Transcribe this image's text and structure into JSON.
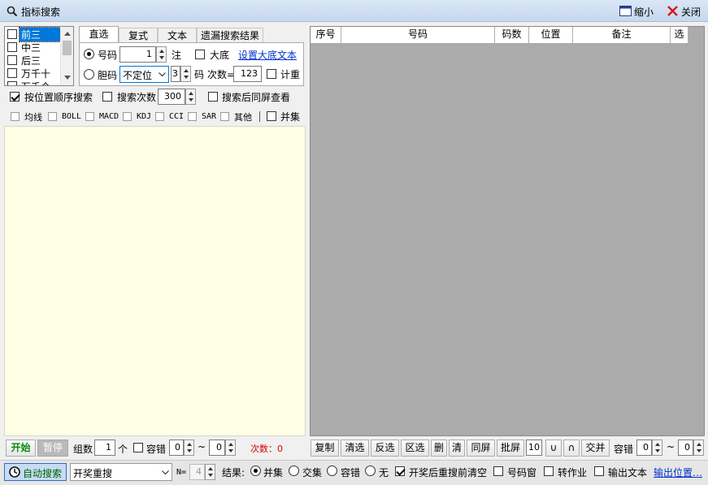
{
  "window": {
    "title": "指标搜索",
    "minimize_label": "缩小",
    "close_label": "关闭"
  },
  "positions": {
    "items": [
      {
        "label": "前三",
        "checked": false,
        "selected": true
      },
      {
        "label": "中三",
        "checked": false
      },
      {
        "label": "后三",
        "checked": false
      },
      {
        "label": "万千十",
        "checked": false
      },
      {
        "label": "万千个",
        "checked": false
      }
    ]
  },
  "tabs": [
    {
      "label": "直选",
      "active": true
    },
    {
      "label": "复式"
    },
    {
      "label": "文本"
    },
    {
      "label": "遗漏搜索结果"
    }
  ],
  "direct": {
    "haoma_label": "号码",
    "haoma_value": "1",
    "zhu_label": "注",
    "dadi_label": "大底",
    "dadi_link": "设置大底文本",
    "danma_label": "胆码",
    "danma_select": "不定位",
    "ma_value": "3",
    "ma_label": "码",
    "cishu_label": "次数=",
    "cishu_value": "123",
    "jizhong_label": "计重"
  },
  "options": {
    "order_search": "按位置顺序搜索",
    "search_count_label": "搜索次数",
    "search_count_value": "300",
    "same_screen": "搜索后同屏查看"
  },
  "indicators": [
    "均线",
    "BOLL",
    "MACD",
    "KDJ",
    "CCI",
    "SAR",
    "其他"
  ],
  "indicators_union": "并集",
  "grid_headers": [
    "序号",
    "号码",
    "码数",
    "位置",
    "备注",
    "选"
  ],
  "left_bottom": {
    "start": "开始",
    "pause": "暂停",
    "group_label": "组数",
    "group_value": "1",
    "ge_label": "个",
    "tolerance_label": "容错",
    "tol_from": "0",
    "tilde": "~",
    "tol_to": "0",
    "count_text": "次数：0"
  },
  "right_bottom": {
    "buttons": [
      "复制",
      "清选",
      "反选",
      "区选",
      "删",
      "清",
      "同屏",
      "批屏"
    ],
    "pi_value": "10",
    "union_sym": "∪",
    "intersect_sym": "∩",
    "jiaobing": "交并",
    "tolerance_label": "容错",
    "tol_from": "0",
    "tilde": "~",
    "tol_to": "0"
  },
  "statusbar": {
    "auto_search": "自动搜索",
    "mode_select": "开奖重搜",
    "n_label": "N=",
    "n_value": "4",
    "result_label": "结果:",
    "results": [
      {
        "label": "并集",
        "on": true
      },
      {
        "label": "交集",
        "on": false
      },
      {
        "label": "容错",
        "on": false
      },
      {
        "label": "无",
        "on": false
      }
    ],
    "checks": [
      {
        "label": "开奖后重搜前清空",
        "on": true
      },
      {
        "label": "号码窗",
        "on": false
      },
      {
        "label": "转作业",
        "on": false
      },
      {
        "label": "输出文本",
        "on": false
      }
    ],
    "output_link": "输出位置…"
  }
}
